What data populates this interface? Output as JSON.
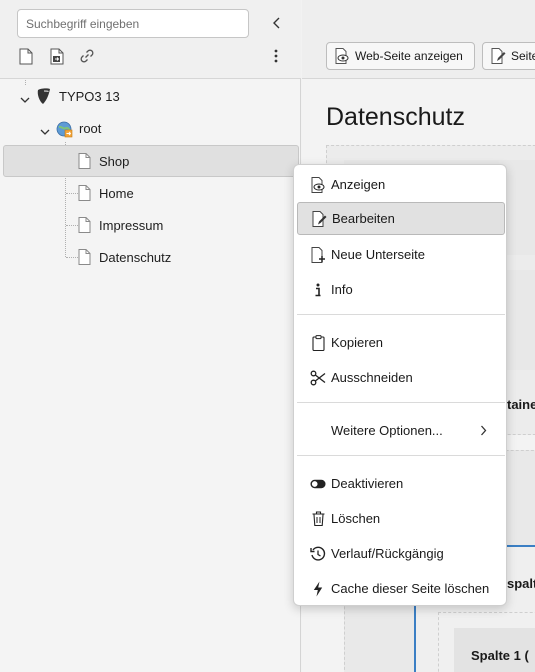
{
  "tree_toolbar": {
    "search_placeholder": "Suchbegriff eingeben",
    "icons": [
      "new-page-icon",
      "page-mount-icon",
      "link-icon",
      "more-vertical-icon",
      "collapse-left-icon"
    ]
  },
  "tree": {
    "items": [
      {
        "label": "TYPO3 13",
        "icon": "typo3-logo-icon"
      },
      {
        "label": "root",
        "icon": "site-root-icon"
      },
      {
        "label": "Shop",
        "icon": "page-icon"
      },
      {
        "label": "Home",
        "icon": "page-icon"
      },
      {
        "label": "Impressum",
        "icon": "page-icon"
      },
      {
        "label": "Datenschutz",
        "icon": "page-icon"
      }
    ]
  },
  "content": {
    "buttons": [
      {
        "label": "Web-Seite anzeigen",
        "icon": "eye-icon"
      },
      {
        "label": "Seite",
        "icon": "edit-page-icon"
      }
    ],
    "heading": "Datenschutz",
    "fragments": [
      "taine",
      "spalt",
      "Spalte 1 ("
    ]
  },
  "context_menu": {
    "items": [
      {
        "label": "Anzeigen",
        "icon": "view-icon"
      },
      {
        "label": "Bearbeiten",
        "icon": "edit-icon"
      },
      {
        "label": "Neue Unterseite",
        "icon": "new-subpage-icon"
      },
      {
        "label": "Info",
        "icon": "info-icon"
      },
      {
        "label": "Kopieren",
        "icon": "clipboard-icon"
      },
      {
        "label": "Ausschneiden",
        "icon": "scissors-icon"
      },
      {
        "label": "Weitere Optionen...",
        "icon": "chevron-right-icon"
      },
      {
        "label": "Deaktivieren",
        "icon": "toggle-icon"
      },
      {
        "label": "Löschen",
        "icon": "trash-icon"
      },
      {
        "label": "Verlauf/Rückgängig",
        "icon": "history-icon"
      },
      {
        "label": "Cache dieser Seite löschen",
        "icon": "lightning-icon"
      }
    ],
    "highlighted": "Bearbeiten"
  }
}
